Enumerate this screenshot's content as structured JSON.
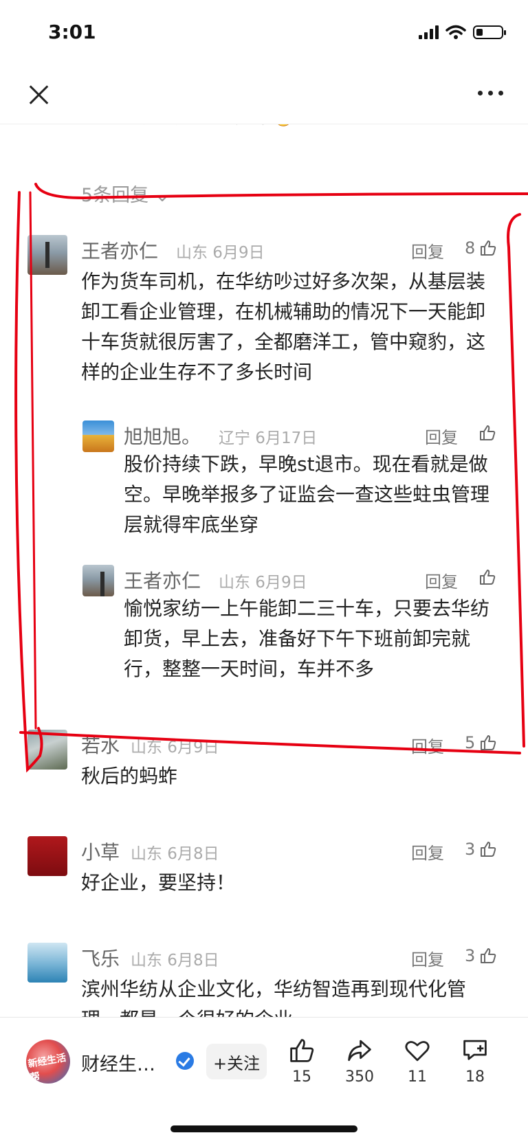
{
  "status": {
    "time": "3:01"
  },
  "thread": {
    "partial_text": "一定会再此好起来✊",
    "replies_link": "5条回复 ⌄"
  },
  "comments": [
    {
      "name": "王者亦仁",
      "meta": "山东 6月9日",
      "reply": "回复",
      "likes": "8",
      "text": "作为货车司机，在华纺吵过好多次架，从基层装卸工看企业管理，在机械辅助的情况下一天能卸十车货就很厉害了，全都磨洋工，管中窥豹，这样的企业生存不了多长时间"
    },
    {
      "name": "旭旭旭。",
      "meta": "辽宁 6月17日",
      "reply": "回复",
      "likes": "",
      "text": "股价持续下跌，早晚st退市。现在看就是做空。早晚举报多了证监会一查这些蛀虫管理层就得牢底坐穿"
    },
    {
      "name": "王者亦仁",
      "meta": "山东 6月9日",
      "reply": "回复",
      "likes": "",
      "text": "愉悦家纺一上午能卸二三十车，只要去华纺卸货，早上去，准备好下午下班前卸完就行，整整一天时间，车并不多"
    },
    {
      "name": "若水",
      "meta": "山东 6月9日",
      "reply": "回复",
      "likes": "5",
      "text": "秋后的蚂蚱"
    },
    {
      "name": "小草",
      "meta": "山东 6月8日",
      "reply": "回复",
      "likes": "3",
      "text": "好企业，要坚持！"
    },
    {
      "name": "飞乐",
      "meta": "山东 6月8日",
      "reply": "回复",
      "likes": "3",
      "text": "滨州华纺从企业文化，华纺智造再到现代化管理，都是一个很好的企业"
    }
  ],
  "bottom": {
    "publisher": "财经生…",
    "avatar_text": "新经生活帮",
    "follow": "+关注",
    "likes": "15",
    "shares": "350",
    "favorites": "11",
    "comments": "18"
  }
}
